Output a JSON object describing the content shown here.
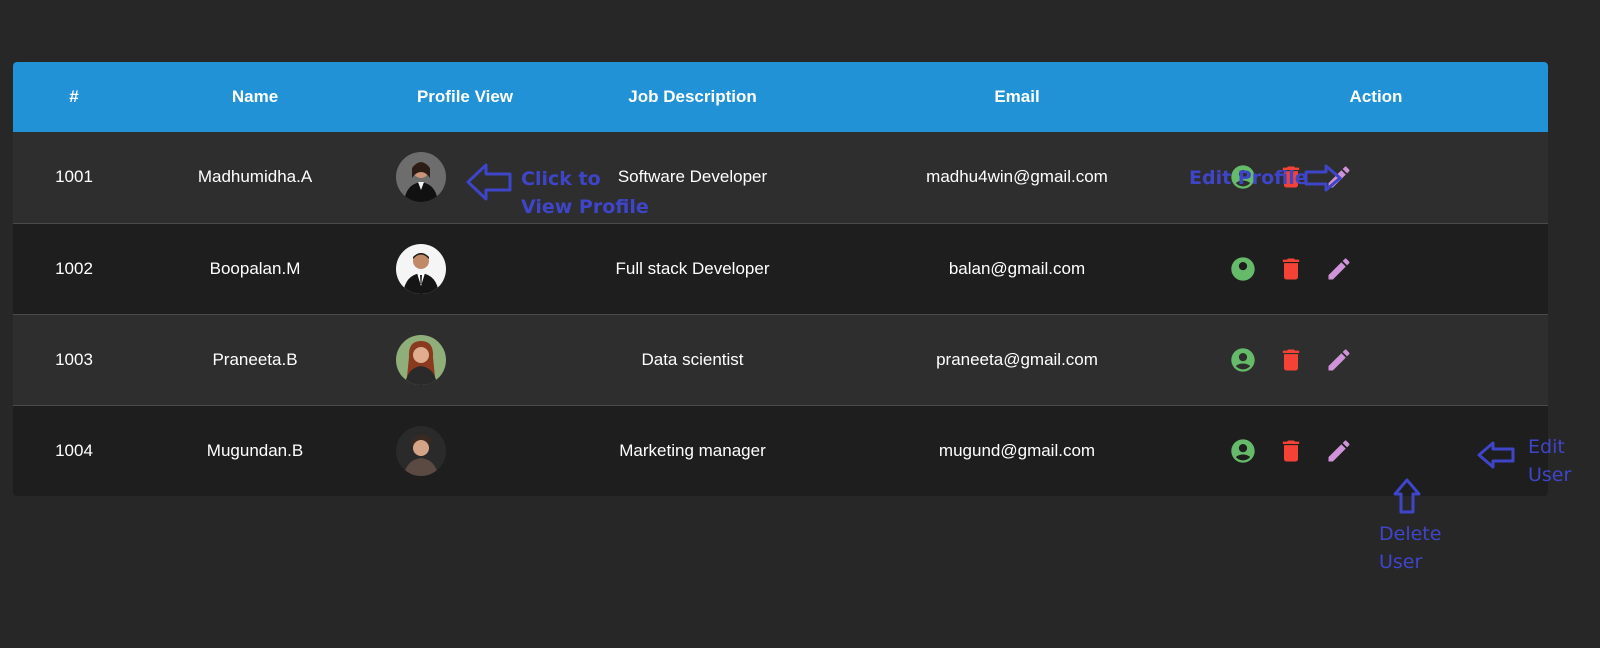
{
  "table": {
    "headers": [
      "#",
      "Name",
      "Profile View",
      "Job Description",
      "Email",
      "Action"
    ],
    "rows": [
      {
        "id": "1001",
        "name": "Madhumidha.A",
        "job": "Software Developer",
        "email": "madhu4win@gmail.com",
        "avatar": "avatar-woman-suit"
      },
      {
        "id": "1002",
        "name": "Boopalan.M",
        "job": "Full stack Developer",
        "email": "balan@gmail.com",
        "avatar": "avatar-man-suit"
      },
      {
        "id": "1003",
        "name": "Praneeta.B",
        "job": "Data scientist",
        "email": "praneeta@gmail.com",
        "avatar": "avatar-woman-redhair"
      },
      {
        "id": "1004",
        "name": "Mugundan.B",
        "job": "Marketing manager",
        "email": "mugund@gmail.com",
        "avatar": "avatar-man-casual"
      }
    ],
    "action_icons": [
      "account-circle-icon",
      "trash-icon",
      "pencil-icon"
    ]
  },
  "annotations": {
    "view_profile_1": "Click to",
    "view_profile_2": "View Profile",
    "edit_profile": "Edit Profile",
    "edit_user_1": "Edit",
    "edit_user_2": "User",
    "delete_user_1": "Delete",
    "delete_user_2": "User"
  },
  "colors": {
    "header_bg": "#2292d7",
    "profile_icon": "#66bb6a",
    "delete_icon": "#f44336",
    "edit_icon": "#ce93d8",
    "annotation": "#3f45c9"
  }
}
